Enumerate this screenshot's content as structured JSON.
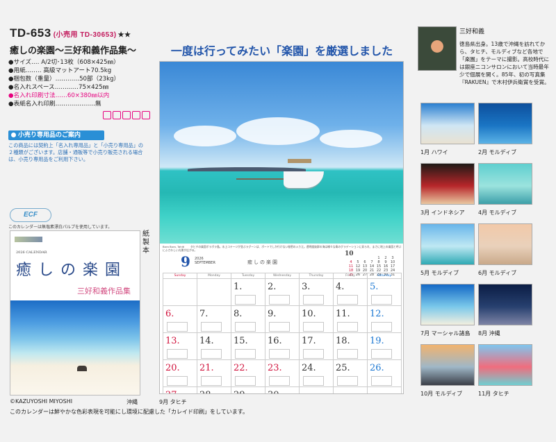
{
  "product": {
    "code": "TD-653",
    "retail_code": "(小売用 TD-30653)",
    "stars": "★★",
    "title": "癒しの楽園〜三好和義作品集〜"
  },
  "specs": [
    {
      "text": "●サイズ‥‥ A/2切･13枚（608×425㎜）",
      "highlight": false
    },
    {
      "text": "●用紙‥‥‥‥ 高級マットアート70.5kg",
      "highlight": false
    },
    {
      "text": "●梱包数（重量）‥‥‥‥‥‥50部（23kg）",
      "highlight": false
    },
    {
      "text": "●名入れスペース‥‥‥‥‥‥75×425㎜",
      "highlight": false
    },
    {
      "text": "●名入れ印刷寸法‥‥‥60×380㎜以内",
      "highlight": true
    },
    {
      "text": "●表紙名入れ印刷‥‥‥‥‥‥‥‥‥‥無",
      "highlight": false
    }
  ],
  "spec_icons": [
    "icon-a",
    "icon-b",
    "icon-c",
    "icon-d",
    "icon-e"
  ],
  "retail": {
    "heading": "小売り専用品のご案内",
    "text": "この商品には契約上「名入れ専用品」と「小売り専用品」の２種類がございます。店舗・通販等で小売り販売される場合は、小売り専用品をご利用下さい。"
  },
  "ecf": {
    "logo": "ECF",
    "note": "このカレンダーは無塩素漂白パルプを使用しています。"
  },
  "cover": {
    "year_label": "2026 CALENDAR",
    "title": "癒しの楽園",
    "author": "三好和義作品集",
    "caption": "沖縄"
  },
  "paper_mark": "紙製本",
  "copyright": "©KAZUYOSHI MIYOSHI",
  "footnote": "このカレンダーは鮮やかな色彩表現を可能にし環境に配慮した「カレイド印刷」をしています。",
  "headline": "一度は行ってみたい「楽園」を厳選しました",
  "calendar": {
    "month": "9",
    "year": "2026",
    "month_en": "SEPTEMBER",
    "title": "癒しの楽園",
    "photo_location": "Bora Bora, Tahiti",
    "photo_caption": "タヒチの楽園ボラボラ島。水上コテージが並ぶラグーンは、ボートでしか行けない秘密の入り江。透明度抜群の海は様々な青のグラデーションに彩られ、まさに地上の楽園と呼ぶにふさわしい光景が広がる。",
    "mini_month": "10",
    "mini_rows": [
      [
        "",
        "",
        "",
        "",
        "1",
        "2",
        "3"
      ],
      [
        "4",
        "5",
        "6",
        "7",
        "8",
        "9",
        "10"
      ],
      [
        "11",
        "12",
        "13",
        "14",
        "15",
        "16",
        "17"
      ],
      [
        "18",
        "19",
        "20",
        "21",
        "22",
        "23",
        "24"
      ],
      [
        "25",
        "26",
        "27",
        "28",
        "29",
        "30",
        "31"
      ]
    ],
    "weekdays": [
      "Sunday",
      "Monday",
      "Tuesday",
      "Wednesday",
      "Thursday",
      "Friday",
      "Saturday"
    ],
    "weeks": [
      [
        {
          "d": ""
        },
        {
          "d": ""
        },
        {
          "d": "1."
        },
        {
          "d": "2."
        },
        {
          "d": "3."
        },
        {
          "d": "4."
        },
        {
          "d": "5."
        }
      ],
      [
        {
          "d": "6."
        },
        {
          "d": "7."
        },
        {
          "d": "8."
        },
        {
          "d": "9."
        },
        {
          "d": "10."
        },
        {
          "d": "11."
        },
        {
          "d": "12."
        }
      ],
      [
        {
          "d": "13."
        },
        {
          "d": "14."
        },
        {
          "d": "15."
        },
        {
          "d": "16."
        },
        {
          "d": "17."
        },
        {
          "d": "18."
        },
        {
          "d": "19."
        }
      ],
      [
        {
          "d": "20."
        },
        {
          "d": "21.",
          "hol": true
        },
        {
          "d": "22.",
          "hol": true
        },
        {
          "d": "23.",
          "hol": true
        },
        {
          "d": "24."
        },
        {
          "d": "25."
        },
        {
          "d": "26."
        }
      ],
      [
        {
          "d": "27."
        },
        {
          "d": "28."
        },
        {
          "d": "29."
        },
        {
          "d": "30."
        },
        {
          "d": ""
        },
        {
          "d": ""
        },
        {
          "d": ""
        }
      ]
    ],
    "caption": "9月 タヒチ"
  },
  "photographer": {
    "name": "三好和義",
    "bio": "徳島県出身。13歳で沖縄を訪れてから、タヒチ、モルディブなど各地で「楽園」をテーマに撮影。高校時代には銀座ニコンサロンにおいて当時最年少で個展を開く。85年、初の写真集『RAKUEN』で木村伊兵衛賞を受賞。"
  },
  "months": [
    {
      "label": "1月 ハワイ",
      "colors": [
        "#2a7fd0",
        "#cfe6f4",
        "#e9e2d2"
      ]
    },
    {
      "label": "2月 モルディブ",
      "colors": [
        "#0d4f9c",
        "#1a75c4",
        "#5cb3e6"
      ]
    },
    {
      "label": "3月 インドネシア",
      "colors": [
        "#1f1a16",
        "#b7262a",
        "#e9c7a0"
      ]
    },
    {
      "label": "4月 モルディブ",
      "colors": [
        "#5fcfcf",
        "#9be3de",
        "#3c9fa8"
      ]
    },
    {
      "label": "5月 モルディブ",
      "colors": [
        "#68b5ea",
        "#bfe8f3",
        "#2ea9b4"
      ]
    },
    {
      "label": "6月 モルディブ",
      "colors": [
        "#f2c9a9",
        "#e9d1bb",
        "#c9a98a"
      ]
    },
    {
      "label": "7月 マーシャル諸島",
      "colors": [
        "#1469c6",
        "#7ac8ea",
        "#f2efe0"
      ]
    },
    {
      "label": "8月 沖縄",
      "colors": [
        "#0b1d44",
        "#27406f",
        "#7e84a5"
      ]
    },
    {
      "label": "10月 モルディブ",
      "colors": [
        "#f1b36f",
        "#9fb7c7",
        "#3b3f48"
      ]
    },
    {
      "label": "11月 タヒチ",
      "colors": [
        "#7fc6ee",
        "#f06d7d",
        "#6fcfd2"
      ]
    }
  ]
}
